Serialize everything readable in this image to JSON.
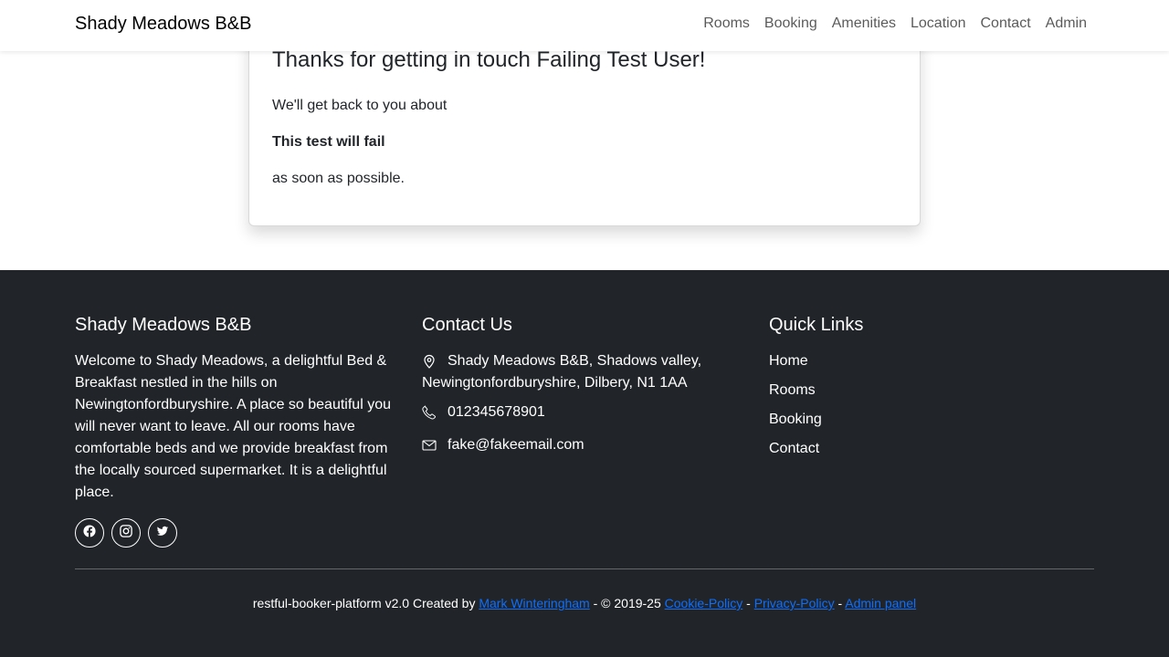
{
  "navbar": {
    "brand": "Shady Meadows B&B",
    "links": [
      "Rooms",
      "Booking",
      "Amenities",
      "Location",
      "Contact",
      "Admin"
    ]
  },
  "confirmation": {
    "heading": "Thanks for getting in touch Failing Test User!",
    "line1": "We'll get back to you about",
    "subject": "This test will fail",
    "line3": "as soon as possible."
  },
  "footer": {
    "about": {
      "title": "Shady Meadows B&B",
      "text": "Welcome to Shady Meadows, a delightful Bed & Breakfast nestled in the hills on Newingtonfordburyshire. A place so beautiful you will never want to leave. All our rooms have comfortable beds and we provide breakfast from the locally sourced supermarket. It is a delightful place.",
      "socials": [
        "facebook-icon",
        "instagram-icon",
        "twitter-icon"
      ]
    },
    "contact": {
      "title": "Contact Us",
      "address": "Shady Meadows B&B, Shadows valley, Newingtonfordburyshire, Dilbery, N1 1AA",
      "phone": "012345678901",
      "email": "fake@fakeemail.com"
    },
    "quick_links": {
      "title": "Quick Links",
      "items": [
        "Home",
        "Rooms",
        "Booking",
        "Contact"
      ]
    },
    "copyright": {
      "prefix": "restful-booker-platform v2.0 Created by ",
      "author": "Mark Winteringham",
      "mid": " - © 2019-25 ",
      "cookie": "Cookie-Policy",
      "sep1": " - ",
      "privacy": "Privacy-Policy",
      "sep2": " - ",
      "admin": "Admin panel"
    }
  },
  "colors": {
    "footer_bg": "#212529",
    "link_blue": "#0d6efd"
  }
}
